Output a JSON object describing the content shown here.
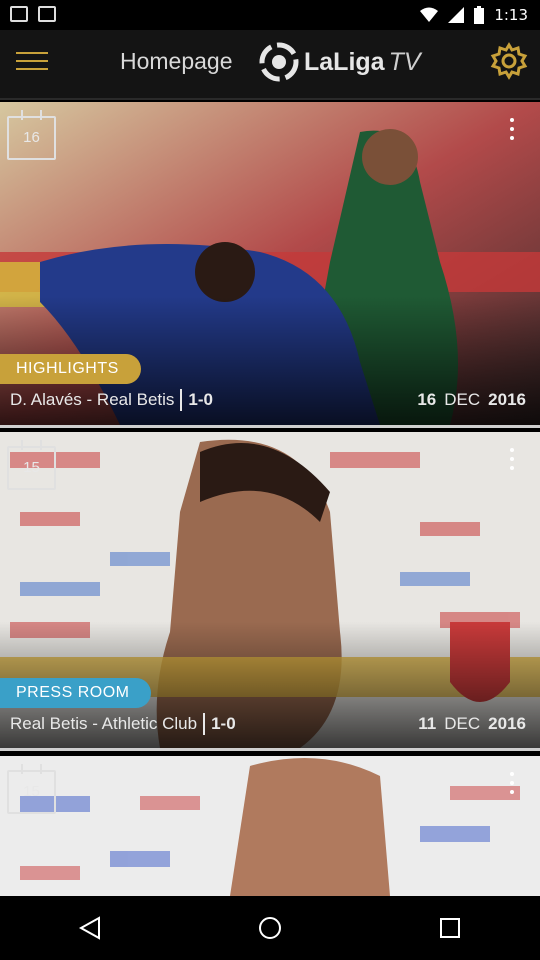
{
  "status_bar": {
    "time": "1:13"
  },
  "app_bar": {
    "title": "Homepage",
    "logo_text": "LaLiga",
    "logo_suffix": "TV",
    "accent_color": "#c8a13a"
  },
  "cards": [
    {
      "day_badge": "16",
      "category": "HIGHLIGHTS",
      "category_color": "#c8a13a",
      "match": "D. Alavés - Real Betis",
      "score": "1-0",
      "date_day": "16",
      "date_month": "DEC",
      "date_year": "2016",
      "icons": {
        "calendar": "calendar-icon",
        "more": "more-vert-icon"
      }
    },
    {
      "day_badge": "15",
      "category": "PRESS ROOM",
      "category_color": "#3aa0c8",
      "match": "Real Betis - Athletic Club",
      "score": "1-0",
      "date_day": "11",
      "date_month": "DEC",
      "date_year": "2016",
      "icons": {
        "calendar": "calendar-icon",
        "more": "more-vert-icon"
      }
    },
    {
      "day_badge": "15",
      "icons": {
        "calendar": "calendar-icon",
        "more": "more-vert-icon"
      }
    }
  ],
  "nav_bar": {
    "back": "back-icon",
    "home": "home-icon",
    "recents": "recents-icon"
  }
}
